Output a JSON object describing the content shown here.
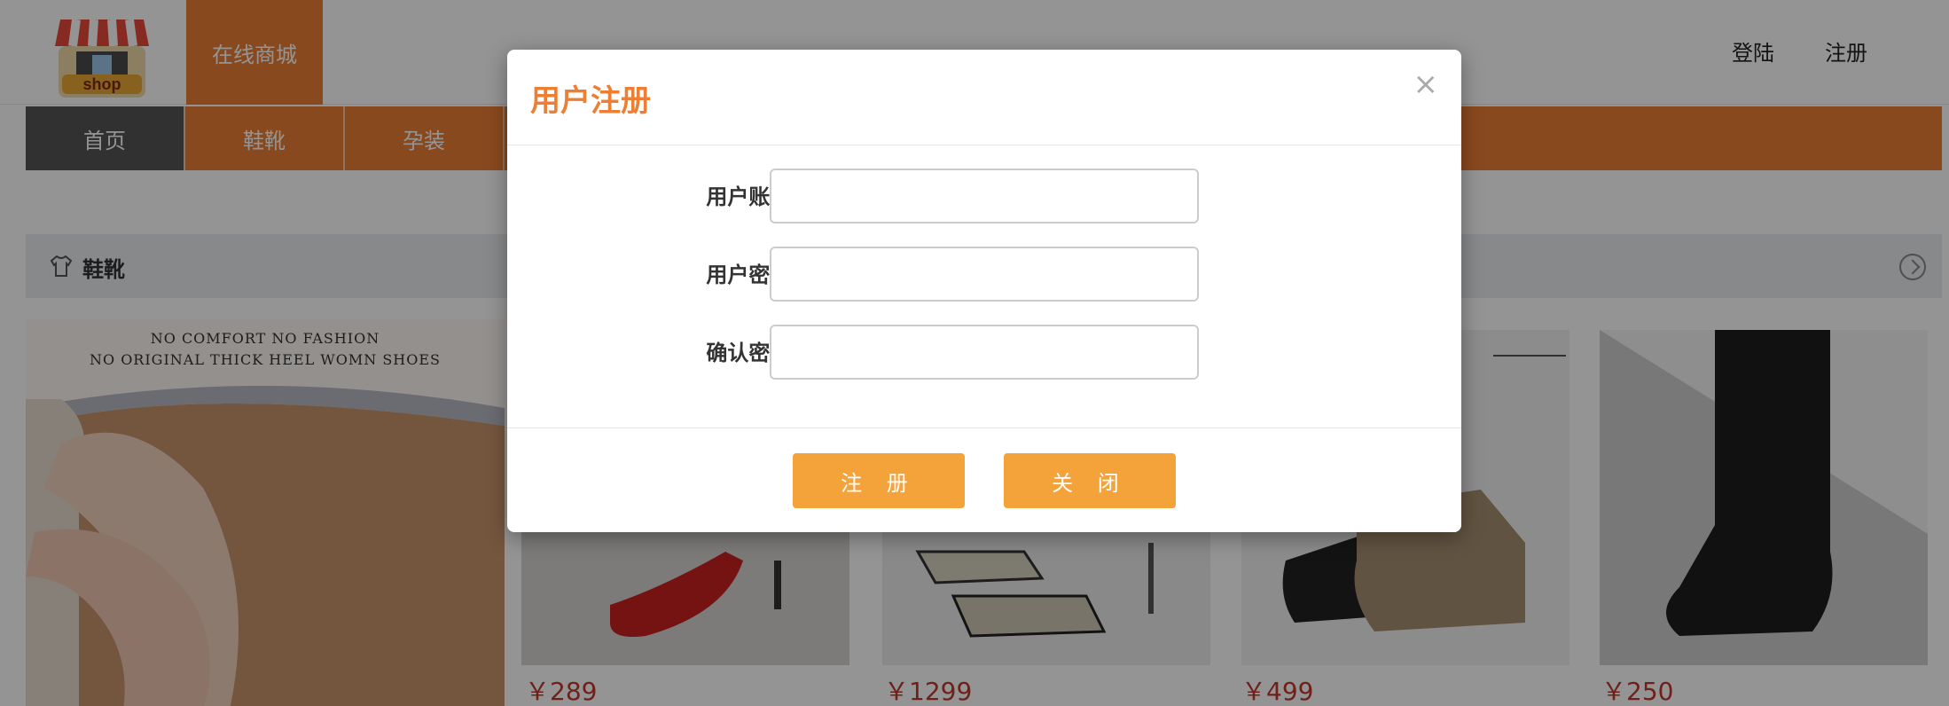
{
  "header": {
    "logo_text": "shop",
    "site_name": "在线商城",
    "login_link": "登陆",
    "register_link": "注册"
  },
  "nav": {
    "items": [
      "首页",
      "鞋靴",
      "孕装"
    ]
  },
  "section": {
    "title": "鞋靴"
  },
  "banner": {
    "line1": "NO COMFORT  NO FASHION",
    "line2": "NO ORIGINAL THICK HEEL WOMN SHOES"
  },
  "products": [
    {
      "price": "￥289"
    },
    {
      "price": "￥1299"
    },
    {
      "price": "￥499"
    },
    {
      "price": "￥250"
    }
  ],
  "partial_banner_text": "N",
  "modal": {
    "title": "用户注册",
    "close_glyph": "×",
    "fields": [
      {
        "label": "用户账号:",
        "value": ""
      },
      {
        "label": "用户密码:",
        "value": ""
      },
      {
        "label": "确认密码:",
        "value": ""
      }
    ],
    "register_button": "注 册",
    "close_button": "关 闭"
  },
  "colors": {
    "accent": "#ec7f34",
    "button": "#f4a23a",
    "price": "#c0392b"
  }
}
